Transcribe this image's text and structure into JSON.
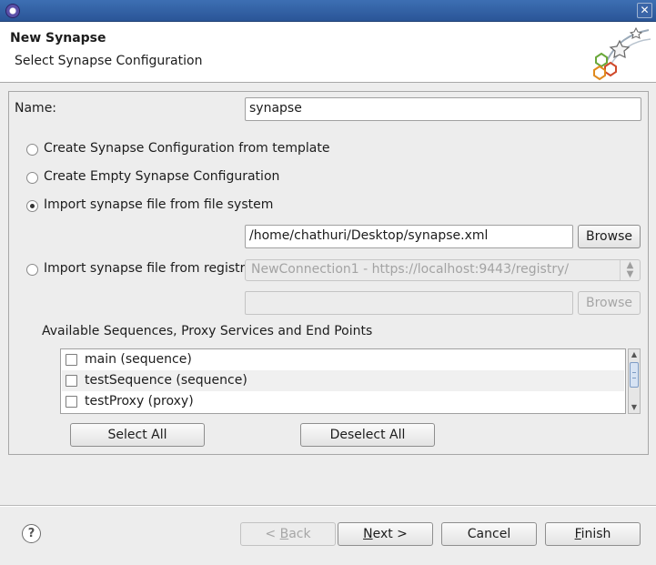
{
  "window": {
    "app_icon": "eclipse-icon",
    "close_icon": "close-icon",
    "close_glyph": "✕"
  },
  "header": {
    "title": "New Synapse",
    "subtitle": "Select Synapse Configuration",
    "logo_icon": "wizard-logo-icon"
  },
  "form": {
    "name_label": "Name:",
    "name_value": "synapse",
    "options": [
      {
        "label": "Create Synapse Configuration from template",
        "checked": false
      },
      {
        "label": "Create Empty Synapse Configuration",
        "checked": false
      },
      {
        "label": "Import synapse file from file system",
        "checked": true
      },
      {
        "label": "Import synapse file from registry",
        "checked": false
      }
    ],
    "file_path": "/home/chathuri/Desktop/synapse.xml",
    "browse_label": "Browse",
    "registry_value": "NewConnection1 - https://localhost:9443/registry/",
    "registry_path": "",
    "registry_browse_label": "Browse",
    "available_label": "Available Sequences, Proxy Services and End Points",
    "items": [
      {
        "label": "main (sequence)",
        "checked": false
      },
      {
        "label": "testSequence (sequence)",
        "checked": false
      },
      {
        "label": "testProxy (proxy)",
        "checked": false
      }
    ],
    "select_all_label": "Select All",
    "deselect_all_label": "Deselect All"
  },
  "footer": {
    "help_glyph": "?",
    "back_prefix": "< ",
    "back_mnemonic": "B",
    "back_rest": "ack",
    "next_mnemonic": "N",
    "next_rest": "ext >",
    "cancel_label": "Cancel",
    "finish_mnemonic": "F",
    "finish_rest": "inish"
  }
}
